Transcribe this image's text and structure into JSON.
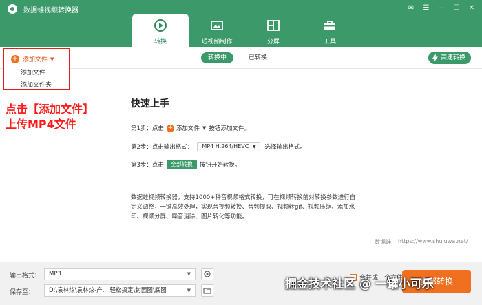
{
  "app": {
    "title": "数据蛙视频转换器"
  },
  "tabs": [
    {
      "label": "转换",
      "icon": "convert-icon",
      "active": true
    },
    {
      "label": "短视频制作",
      "icon": "image-icon",
      "active": false
    },
    {
      "label": "分屏",
      "icon": "split-screen-icon",
      "active": false
    },
    {
      "label": "工具",
      "icon": "toolbox-icon",
      "active": false
    }
  ],
  "subbar": {
    "converting": "转换中",
    "converted": "已转换",
    "fast_convert": "高速转换"
  },
  "add_file": {
    "label": "添加文件",
    "menu": [
      "添加文件",
      "添加文件夹"
    ]
  },
  "annotation": {
    "line1": "点击【添加文件】",
    "line2": "上传MP4文件"
  },
  "guide": {
    "title": "快速上手",
    "step1": {
      "prefix": "第1步：点击",
      "button": "添加文件",
      "suffix": "按钮添加文件。"
    },
    "step2": {
      "prefix": "第2步：点击输出格式：",
      "format": "MP4 H.264/HEVC",
      "suffix": "选择输出格式。"
    },
    "step3": {
      "prefix": "第3步：点击",
      "button": "全部转换",
      "suffix": "按钮开始转换。"
    },
    "description": "数据蛙视频转换器，支持1000+种音视频格式转换，可在视频转换前对转换参数进行自定义调整，一键高效处理，实现音视频转换、音频提取、视频转gif、视频压缩、添加水印、视频分屏、噪音消除、图片转化等功能。"
  },
  "brand": {
    "name": "数据蛙",
    "url": "https://www.shujuwa.net/"
  },
  "bottom": {
    "output_label": "输出格式：",
    "output_value": "MP3",
    "save_label": "保存至：",
    "save_value": "D:\\袁林炫\\袁林炫-产... 轻松搞定\\封面图\\底图",
    "merge_label": "合并成一个文件",
    "start_label": "全部转换"
  },
  "watermark": "掘金技术社区 @ 一罐小可乐",
  "colors": {
    "brand_green": "#3c9a6a",
    "accent_orange": "#f07020",
    "annotation_red": "#ff1a1a"
  }
}
